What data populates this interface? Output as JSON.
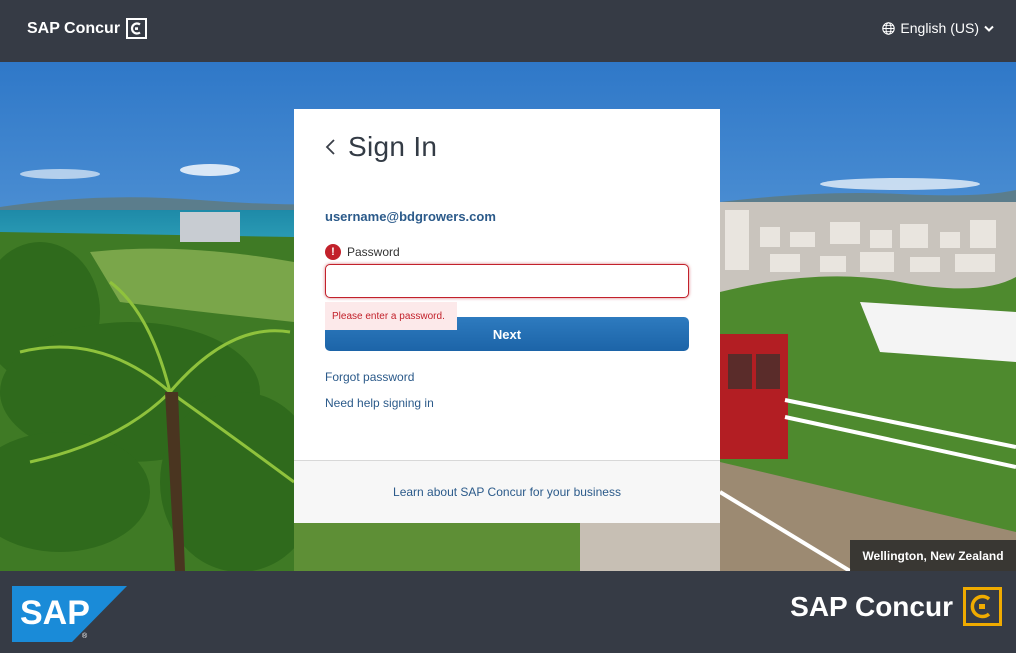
{
  "header": {
    "brand": "SAP Concur",
    "language": "English (US)"
  },
  "signin": {
    "title": "Sign In",
    "username": "username@bdgrowers.com",
    "password_label": "Password",
    "password_value": "",
    "password_error": "Please enter a password.",
    "next_label": "Next",
    "forgot_password": "Forgot password",
    "need_help": "Need help signing in",
    "learn_more": "Learn about SAP Concur for your business"
  },
  "photo": {
    "caption": "Wellington, New Zealand"
  },
  "footer": {
    "sap_logo_text": "SAP",
    "concur_brand": "SAP Concur"
  },
  "colors": {
    "header_bg": "#363b45",
    "primary_button": "#1f6bb0",
    "error": "#c2212b",
    "link": "#2b5a8a",
    "concur_accent": "#f0ab00",
    "sap_blue": "#1a8bd8"
  },
  "icons": {
    "language": "globe-icon",
    "language_toggle": "chevron-down-icon",
    "back": "chevron-left-icon",
    "error": "exclamation-icon"
  }
}
